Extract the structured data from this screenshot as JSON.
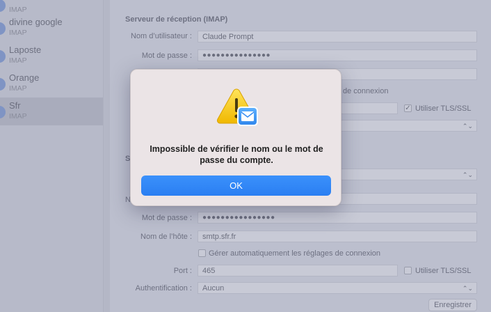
{
  "sidebar": {
    "accounts": [
      {
        "name": "",
        "type": "IMAP"
      },
      {
        "name": "divine google",
        "type": "IMAP"
      },
      {
        "name": "Laposte",
        "type": "IMAP"
      },
      {
        "name": "Orange",
        "type": "IMAP"
      },
      {
        "name": "Sfr",
        "type": "IMAP",
        "selected": true
      }
    ]
  },
  "incoming": {
    "title": "Serveur de réception (IMAP)",
    "username_label": "Nom d’utilisateur :",
    "username_value": "Claude Prompt",
    "password_label": "Mot de passe :",
    "password_value": "●●●●●●●●●●●●●●●",
    "auto_settings_partial": "de connexion",
    "tls_label": "Utiliser TLS/SSL",
    "tls_checked": true
  },
  "outgoing": {
    "section_partial": "S",
    "user_partial": "N",
    "password_label": "Mot de passe :",
    "password_value": "●●●●●●●●●●●●●●●●",
    "host_label": "Nom de l’hôte :",
    "host_value": "smtp.sfr.fr",
    "auto_settings_label": "Gérer automatiquement les réglages de connexion",
    "port_label": "Port :",
    "port_value": "465",
    "tls_label": "Utiliser TLS/SSL",
    "tls_checked": false,
    "auth_label": "Authentification :",
    "auth_value": "Aucun"
  },
  "save_label": "Enregistrer",
  "dialog": {
    "message": "Impossible de vérifier le nom ou le mot de passe du compte.",
    "ok_label": "OK"
  },
  "colors": {
    "accent": "#2a7ef2",
    "dialog_bg": "#ebe4e6",
    "warning": "#f5c400"
  },
  "icons": {
    "dialog": "mail-warning-icon",
    "account": "account-icon",
    "select": "chevron-updown-icon"
  }
}
